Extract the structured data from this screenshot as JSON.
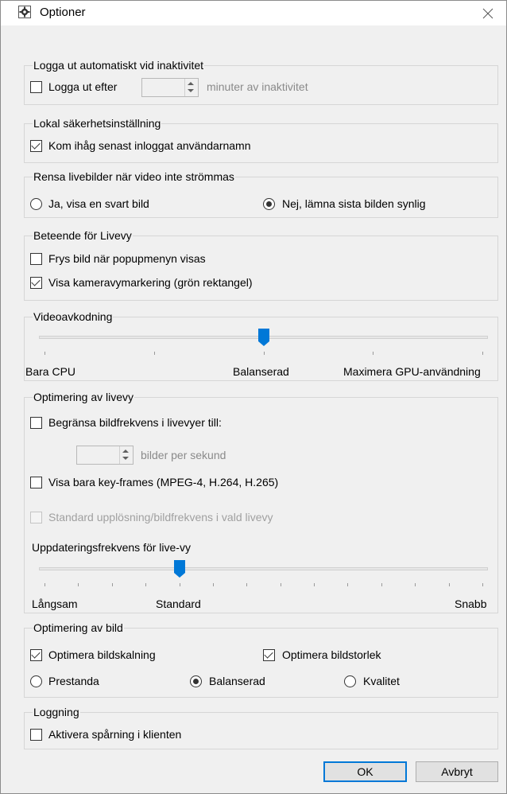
{
  "window": {
    "title": "Optioner"
  },
  "auto_logout": {
    "legend": "Logga ut automatiskt vid inaktivitet",
    "checkbox_label": "Logga ut efter",
    "checked": false,
    "minutes_value": "",
    "unit_label": "minuter av inaktivitet"
  },
  "local_security": {
    "legend": "Lokal säkerhetsinställning",
    "remember_label": "Kom ihåg senast inloggat användarnamn",
    "checked": true
  },
  "clear_live": {
    "legend": "Rensa livebilder när video inte strömmas",
    "option_black": "Ja, visa en svart bild",
    "option_keep": "Nej, lämna sista bilden synlig",
    "selected": "keep"
  },
  "live_behavior": {
    "legend": "Beteende för Livevy",
    "freeze_label": "Frys bild när popupmenyn visas",
    "freeze_checked": false,
    "marker_label": "Visa kameravymarkering (grön rektangel)",
    "marker_checked": true
  },
  "video_decoding": {
    "legend": "Videoavkodning",
    "labels": [
      "Bara CPU",
      "Balanserad",
      "Maximera GPU-användning"
    ],
    "tick_count": 5,
    "position_index": 2
  },
  "live_optimization": {
    "legend": "Optimering av livevy",
    "limit_fps_label": "Begränsa bildfrekvens i livevyer till:",
    "limit_fps_checked": false,
    "fps_value": "",
    "fps_unit": "bilder per sekund",
    "keyframes_label": "Visa bara key-frames (MPEG-4, H.264, H.265)",
    "keyframes_checked": false,
    "default_res_label": "Standard upplösning/bildfrekvens i vald livevy",
    "default_res_checked": false,
    "default_res_disabled": true,
    "update_freq_label": "Uppdateringsfrekvens för live-vy",
    "slider_labels": [
      "Långsam",
      "Standard",
      "Snabb"
    ],
    "tick_count": 14,
    "position_index": 4
  },
  "image_optimization": {
    "legend": "Optimering av bild",
    "scaling_label": "Optimera bildskalning",
    "scaling_checked": true,
    "size_label": "Optimera bildstorlek",
    "size_checked": true,
    "option_performance": "Prestanda",
    "option_balanced": "Balanserad",
    "option_quality": "Kvalitet",
    "selected": "balanced"
  },
  "logging": {
    "legend": "Loggning",
    "tracing_label": "Aktivera spårning i klienten",
    "checked": false
  },
  "buttons": {
    "ok": "OK",
    "cancel": "Avbryt"
  },
  "colors": {
    "accent": "#0078d7",
    "slider_thumb": "#0078d7"
  }
}
